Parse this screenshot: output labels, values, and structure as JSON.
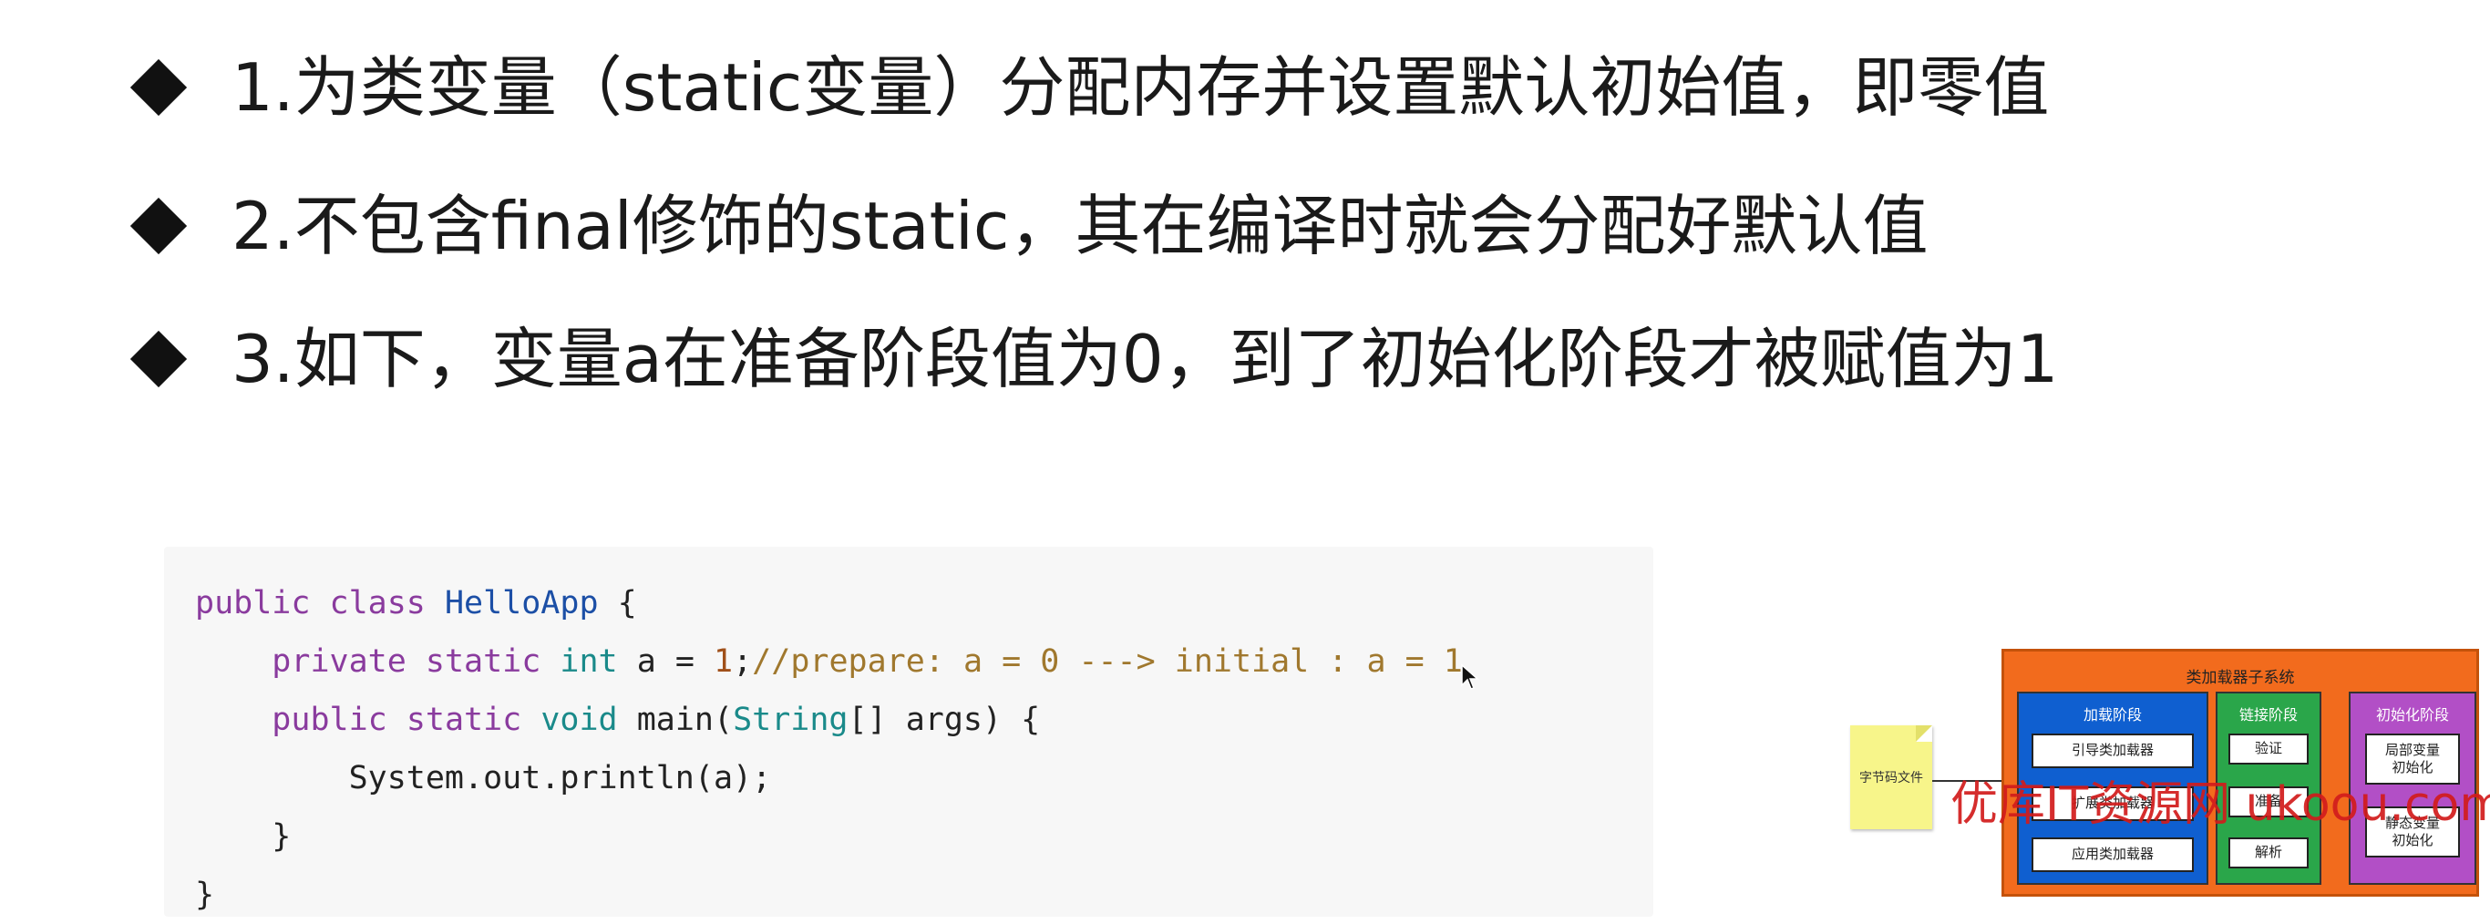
{
  "bullets": [
    "1.为类变量（static变量）分配内存并设置默认初始值，即零值",
    "2.不包含final修饰的static，其在编译时就会分配好默认值",
    "3.如下，变量a在准备阶段值为0，到了初始化阶段才被赋值为1"
  ],
  "code": {
    "line1_kw1": "public",
    "line1_kw2": "class",
    "line1_class": "HelloApp",
    "line1_brace": "{",
    "line2_kw1": "private",
    "line2_kw2": "static",
    "line2_type": "int",
    "line2_var": "a",
    "line2_eq": "=",
    "line2_num": "1",
    "line2_semi": ";",
    "line2_comment": "//prepare: a = 0 ---> initial : a = 1",
    "line3_kw1": "public",
    "line3_kw2": "static",
    "line3_type": "void",
    "line3_name": "main(",
    "line3_argtype": "String",
    "line3_rest": "[] args) {",
    "line4": "System.out.println(a);",
    "line5": "}",
    "line6": "}"
  },
  "diagram": {
    "title": "类加载器子系统",
    "bytecode_file": "字节码文件",
    "loading": {
      "title": "加载阶段",
      "items": [
        "引导类加载器",
        "扩展类加载器",
        "应用类加载器"
      ]
    },
    "linking": {
      "title": "链接阶段",
      "items": [
        "验证",
        "准备",
        "解析"
      ]
    },
    "init": {
      "title": "初始化阶段",
      "items": [
        "局部变量\n初始化",
        "静态变量\n初始化"
      ]
    }
  },
  "watermark": "优库IT资源网 ukoou.com"
}
